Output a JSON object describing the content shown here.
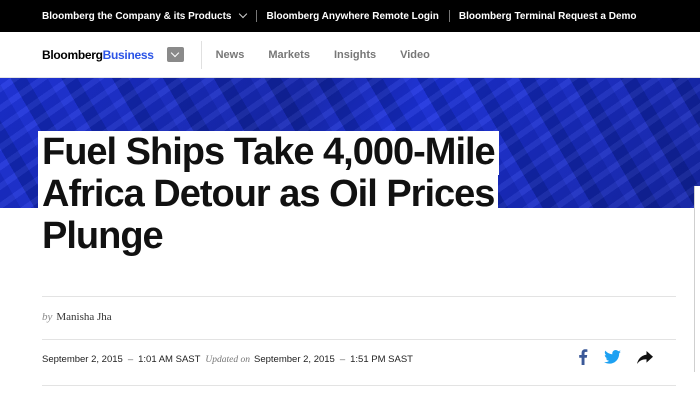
{
  "topbar": {
    "items": [
      {
        "label": "Bloomberg the Company & its Products"
      },
      {
        "label": "Bloomberg Anywhere Remote Login"
      },
      {
        "label": "Bloomberg Terminal Request a Demo"
      }
    ]
  },
  "navbar": {
    "logo_main": "Bloomberg",
    "logo_accent": "Business",
    "links": [
      "News",
      "Markets",
      "Insights",
      "Video"
    ]
  },
  "article": {
    "headline_lines": [
      "Fuel Ships Take 4,000-Mile",
      "Africa Detour as Oil Prices",
      "Plunge"
    ],
    "byline_prefix": "by",
    "author": "Manisha Jha",
    "published": "September 2, 2015",
    "published_time": "1:01 AM SAST",
    "updated_label": "Updated on",
    "updated": "September 2, 2015",
    "updated_time": "1:51 PM SAST",
    "dash": "–"
  },
  "share": {
    "icons": [
      "facebook-icon",
      "twitter-icon",
      "share-arrow-icon"
    ]
  },
  "colors": {
    "brand_blue": "#2b54e6",
    "hero_blue": "#1e34d8",
    "facebook_blue": "#3b5998",
    "twitter_blue": "#1da1f2"
  }
}
